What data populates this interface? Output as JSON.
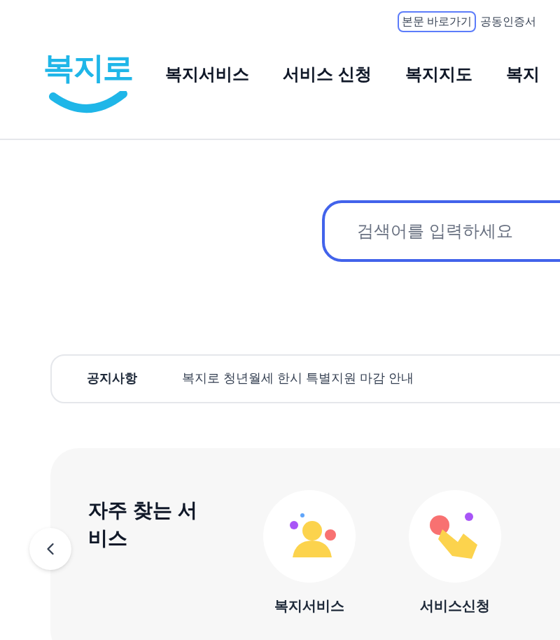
{
  "utility_links": [
    {
      "label": "본문 바로가기",
      "kind": "outlined"
    },
    {
      "label": "공동인증서",
      "kind": "plain"
    }
  ],
  "logo": {
    "text": "복지로"
  },
  "nav": [
    "복지서비스",
    "서비스 신청",
    "복지지도",
    "복지"
  ],
  "search": {
    "placeholder": "검색어를 입력하세요"
  },
  "notice": {
    "label": "공지사항",
    "text": "복지로 청년월세 한시 특별지원 마감 안내"
  },
  "frequent": {
    "title": "자주 찾는 서비스",
    "items": [
      {
        "label": "복지서비스",
        "kind": "person"
      },
      {
        "label": "서비스신청",
        "kind": "tap"
      }
    ]
  }
}
